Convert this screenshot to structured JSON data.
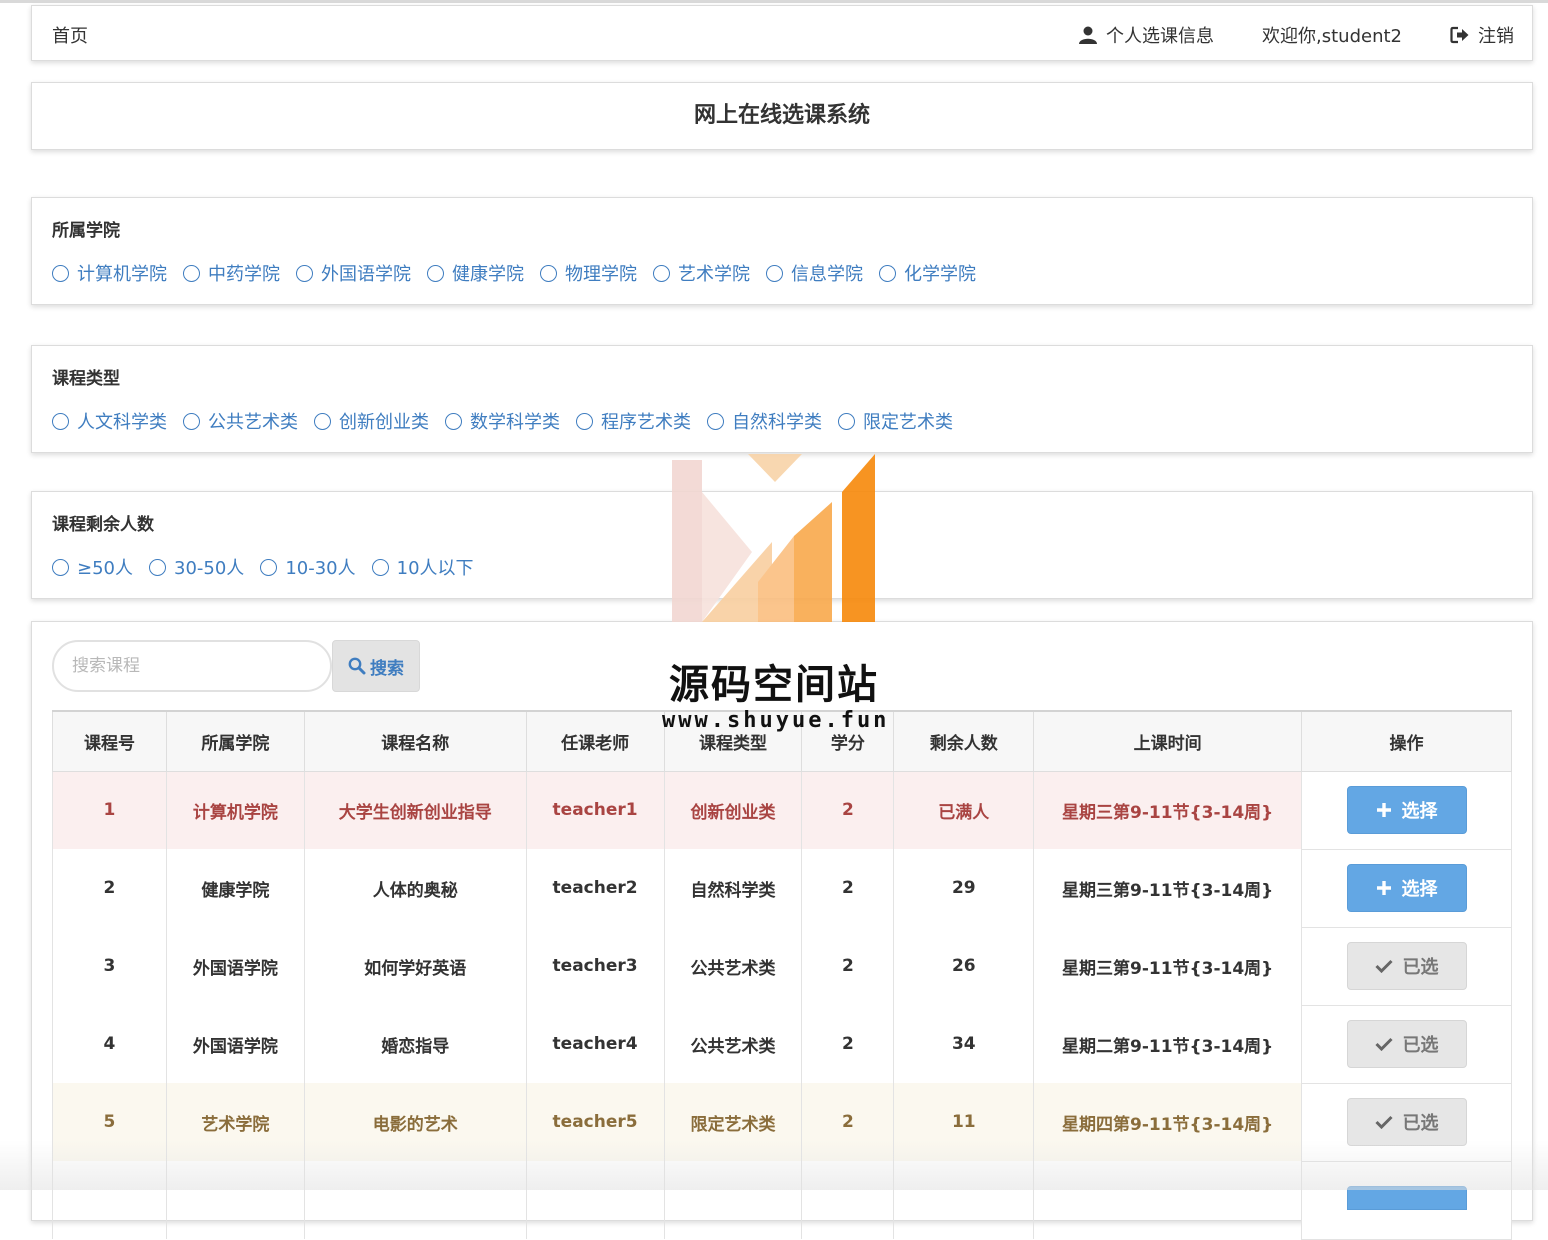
{
  "nav": {
    "home": "首页",
    "personal_info": "个人选课信息",
    "welcome": "欢迎你,student2",
    "logout": "注销"
  },
  "title": "网上在线选课系统",
  "filters": {
    "college": {
      "label": "所属学院",
      "options": [
        "计算机学院",
        "中药学院",
        "外国语学院",
        "健康学院",
        "物理学院",
        "艺术学院",
        "信息学院",
        "化学学院"
      ]
    },
    "course_type": {
      "label": "课程类型",
      "options": [
        "人文科学类",
        "公共艺术类",
        "创新创业类",
        "数学科学类",
        "程序艺术类",
        "自然科学类",
        "限定艺术类"
      ]
    },
    "remaining": {
      "label": "课程剩余人数",
      "options": [
        "≥50人",
        "30-50人",
        "10-30人",
        "10人以下"
      ]
    }
  },
  "search": {
    "placeholder": "搜索课程",
    "button_label": "搜索"
  },
  "table": {
    "headers": [
      "课程号",
      "所属学院",
      "课程名称",
      "任课老师",
      "课程类型",
      "学分",
      "剩余人数",
      "上课时间",
      "操作"
    ],
    "rows": [
      {
        "id": "1",
        "college": "计算机学院",
        "name": "大学生创新创业指导",
        "teacher": "teacher1",
        "type": "创新创业类",
        "credit": "2",
        "remaining": "已满人",
        "time": "星期三第9-11节{3-14周}",
        "action": "选择"
      },
      {
        "id": "2",
        "college": "健康学院",
        "name": "人体的奥秘",
        "teacher": "teacher2",
        "type": "自然科学类",
        "credit": "2",
        "remaining": "29",
        "time": "星期三第9-11节{3-14周}",
        "action": "选择"
      },
      {
        "id": "3",
        "college": "外国语学院",
        "name": "如何学好英语",
        "teacher": "teacher3",
        "type": "公共艺术类",
        "credit": "2",
        "remaining": "26",
        "time": "星期三第9-11节{3-14周}",
        "action": "已选"
      },
      {
        "id": "4",
        "college": "外国语学院",
        "name": "婚恋指导",
        "teacher": "teacher4",
        "type": "公共艺术类",
        "credit": "2",
        "remaining": "34",
        "time": "星期二第9-11节{3-14周}",
        "action": "已选"
      },
      {
        "id": "5",
        "college": "艺术学院",
        "name": "电影的艺术",
        "teacher": "teacher5",
        "type": "限定艺术类",
        "credit": "2",
        "remaining": "11",
        "time": "星期四第9-11节{3-14周}",
        "action": "已选"
      }
    ]
  },
  "watermark": {
    "title": "源码空间站",
    "url": "www.shuyue.fun"
  },
  "colors": {
    "link_blue": "#3f7dc0",
    "choose_button": "#63a7e4",
    "danger_row": "#fbefef",
    "warning_row": "#fbf8ef"
  }
}
